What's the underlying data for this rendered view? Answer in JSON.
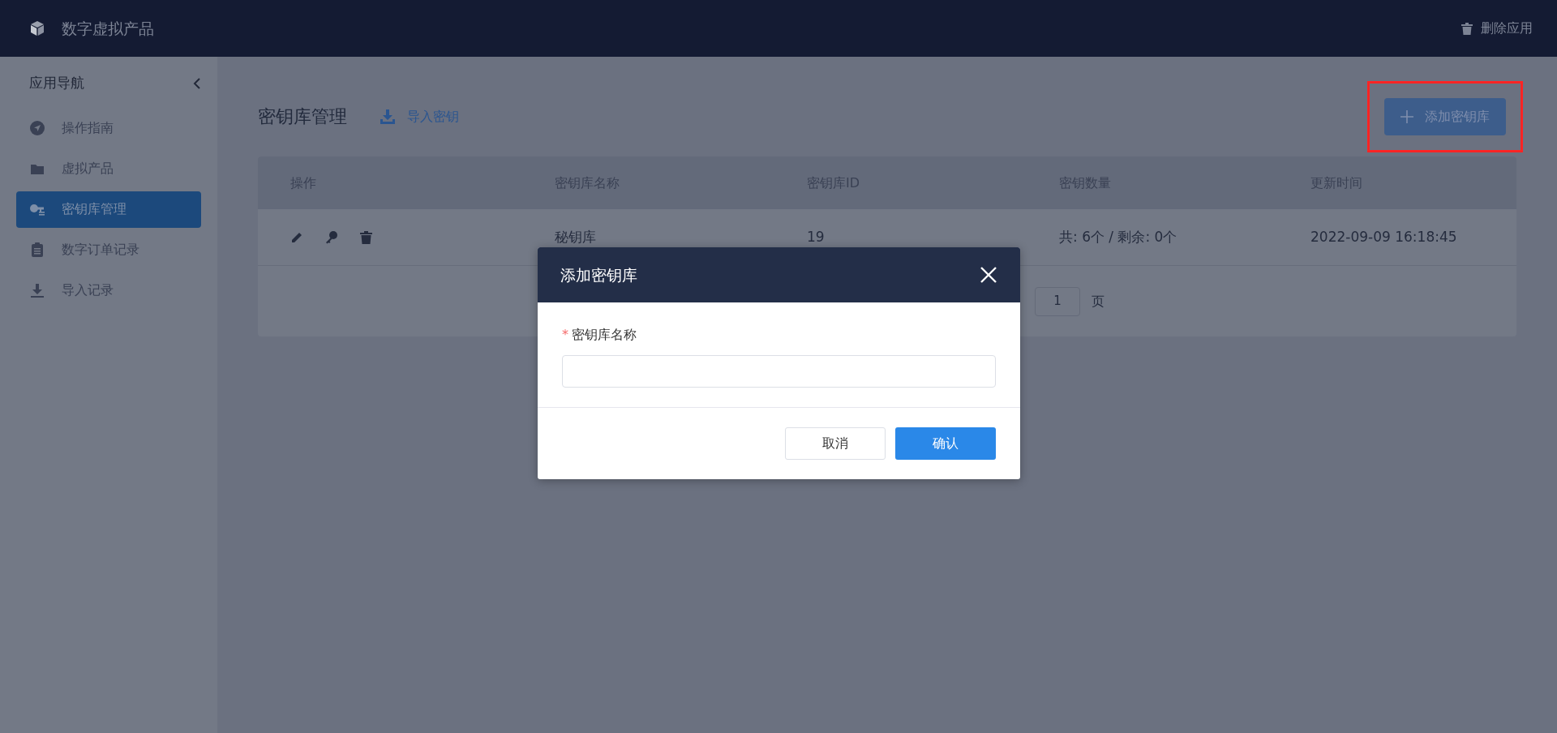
{
  "app_bar": {
    "title": "数字虚拟产品",
    "delete_label": "删除应用"
  },
  "sidebar": {
    "heading": "应用导航",
    "items": [
      {
        "label": "操作指南",
        "selected": false
      },
      {
        "label": "虚拟产品",
        "selected": false
      },
      {
        "label": "密钥库管理",
        "selected": true
      },
      {
        "label": "数字订单记录",
        "selected": false
      },
      {
        "label": "导入记录",
        "selected": false
      }
    ]
  },
  "page": {
    "title": "密钥库管理",
    "import_label": "导入密钥",
    "add_button": {
      "label": "添加密钥库",
      "highlighted": true
    }
  },
  "table": {
    "columns": [
      "操作",
      "密钥库名称",
      "密钥库ID",
      "密钥数量",
      "更新时间"
    ],
    "rows": [
      {
        "name": "秘钥库",
        "id": "19",
        "count": "共: 6个 / 剩余: 0个",
        "updated": "2022-09-09 16:18:45"
      }
    ],
    "pagination": {
      "page": "1",
      "unit": "页"
    }
  },
  "dialog": {
    "title": "添加密钥库",
    "field_label": "密钥库名称",
    "required_mark": "*",
    "cancel": "取消",
    "confirm": "确认"
  }
}
